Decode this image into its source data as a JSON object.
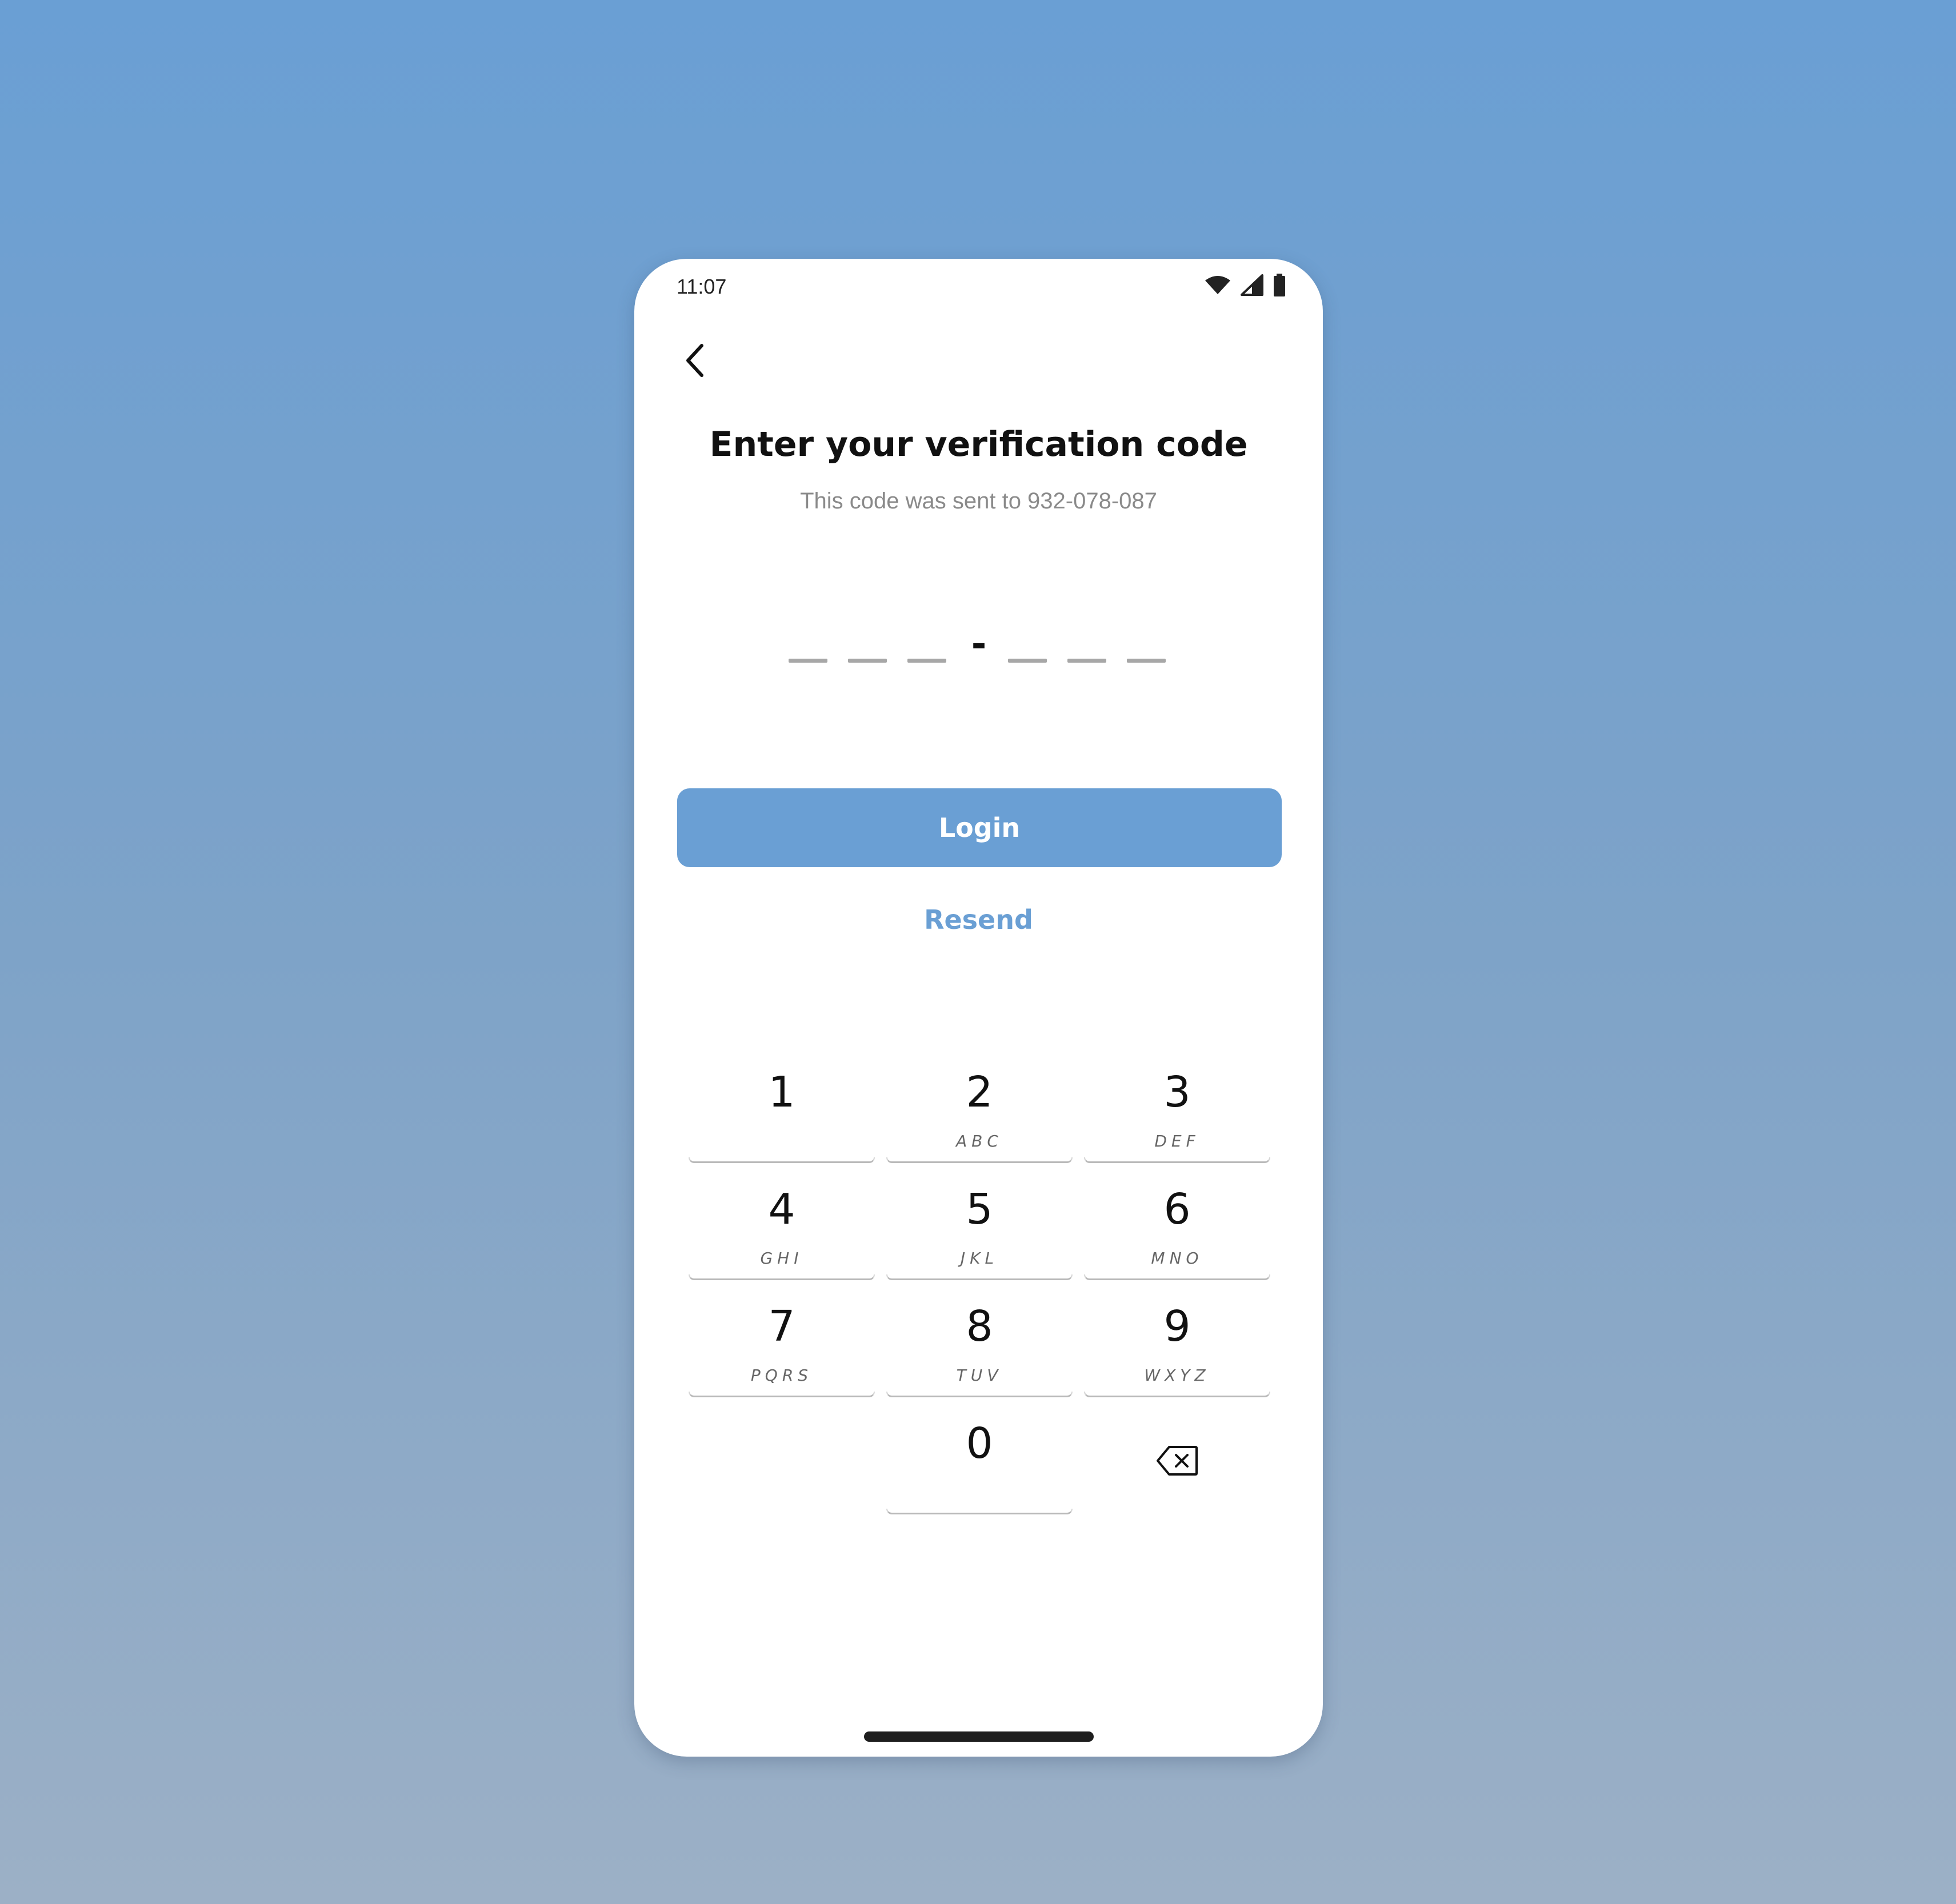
{
  "status_bar": {
    "time": "11:07",
    "icons": [
      "wifi-icon",
      "cellular-signal-icon",
      "battery-icon"
    ]
  },
  "nav": {
    "back_icon": "chevron-left-icon"
  },
  "header": {
    "title": "Enter your verification code",
    "subtitle": "This code was sent to 932-078-087"
  },
  "code_input": {
    "slots_filled": 0,
    "total_slots": 6,
    "separator": "-"
  },
  "actions": {
    "login_label": "Login",
    "resend_label": "Resend"
  },
  "keypad": {
    "keys": [
      {
        "digit": "1",
        "letters": ""
      },
      {
        "digit": "2",
        "letters": "ABC"
      },
      {
        "digit": "3",
        "letters": "DEF"
      },
      {
        "digit": "4",
        "letters": "GHI"
      },
      {
        "digit": "5",
        "letters": "JKL"
      },
      {
        "digit": "6",
        "letters": "MNO"
      },
      {
        "digit": "7",
        "letters": "PQRS"
      },
      {
        "digit": "8",
        "letters": "TUV"
      },
      {
        "digit": "9",
        "letters": "WXYZ"
      },
      {
        "digit": "0",
        "letters": ""
      }
    ],
    "backspace_icon": "backspace-icon"
  },
  "colors": {
    "accent": "#6a9fd4",
    "title_text": "#111111",
    "subtitle_text": "#8a8a8a",
    "background_top": "#6a9fd4",
    "background_bottom": "#9cb0c6"
  }
}
